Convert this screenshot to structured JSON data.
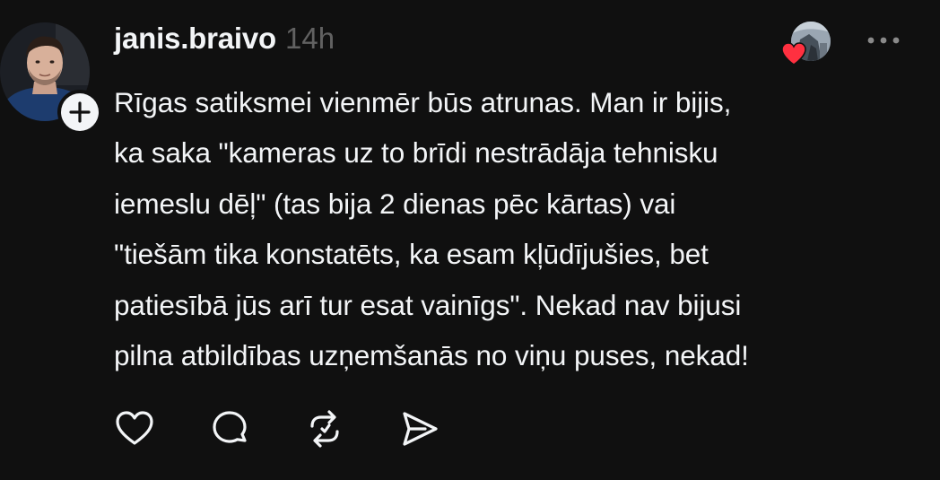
{
  "post": {
    "author": {
      "username": "janis.braivo",
      "avatar_icon": "user-avatar",
      "follow_icon": "plus-icon"
    },
    "timestamp": "14h",
    "body": "Rīgas satiksmei vienmēr būs atrunas. Man ir bijis,\nka saka \"kameras uz to brīdi nestrādāja tehnisku\niemeslu dēļ\" (tas bija 2 dienas pēc kārtas)  vai\n\"tiešām tika konstatēts, ka esam kļūdījušies, bet\npatiesībā jūs arī tur esat vainīgs\". Nekad nav bijusi\npilna atbildības uzņemšanās no viņu puses, nekad!",
    "reply_preview": {
      "avatar_icon": "replier-avatar",
      "reaction_icon": "heart-icon",
      "reaction_color": "#ff3040"
    },
    "more_icon": "ellipsis-icon",
    "actions": [
      {
        "name": "like-button",
        "icon": "heart-outline-icon"
      },
      {
        "name": "comment-button",
        "icon": "comment-icon"
      },
      {
        "name": "repost-button",
        "icon": "repost-icon"
      },
      {
        "name": "share-button",
        "icon": "send-icon"
      }
    ]
  },
  "colors": {
    "background": "#101010",
    "text_primary": "#f3f5f7",
    "text_secondary": "#616161",
    "accent_red": "#ff3040"
  }
}
